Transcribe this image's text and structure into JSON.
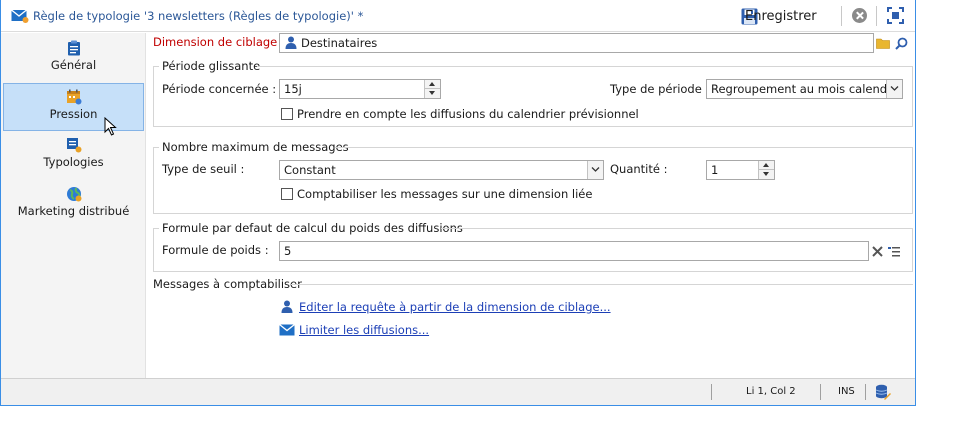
{
  "window": {
    "title": "Règle de typologie '3 newsletters (Règles de typologie)' *",
    "save_label": "Enregistrer",
    "accent_color": "#3a8ee6",
    "title_color": "#2b5797"
  },
  "sidebar": {
    "items": [
      {
        "label": "Général",
        "icon": "clipboard-icon",
        "active": false
      },
      {
        "label": "Pression",
        "icon": "calendar-icon",
        "active": true
      },
      {
        "label": "Typologies",
        "icon": "typology-icon",
        "active": false
      },
      {
        "label": "Marketing distribué",
        "icon": "globe-icon",
        "active": false
      }
    ]
  },
  "targeting": {
    "label": "Dimension de ciblage :",
    "value": "Destinataires",
    "label_color": "#c00000"
  },
  "period_group": {
    "title": "Période glissante",
    "period_label": "Période concernée :",
    "period_value": "15j",
    "type_label": "Type de période :",
    "type_value": "Regroupement au mois calendaire",
    "checkbox_label": "Prendre en compte les diffusions du calendrier prévisionnel"
  },
  "max_group": {
    "title": "Nombre maximum de messages",
    "threshold_label": "Type de seuil :",
    "threshold_value": "Constant",
    "quantity_label": "Quantité :",
    "quantity_value": "1",
    "checkbox_label": "Comptabiliser les messages sur une dimension liée"
  },
  "formula_group": {
    "title": "Formule par defaut de calcul du poids des diffusions",
    "formula_label": "Formule de poids :",
    "formula_value": "5"
  },
  "messages_group": {
    "title": "Messages à comptabiliser",
    "edit_link": "Editer la requête à partir de la dimension de ciblage...",
    "limit_link": "Limiter les diffusions...",
    "link_color": "#1c3fb6"
  },
  "status": {
    "position": "Li 1, Col 2",
    "mode": "INS"
  }
}
